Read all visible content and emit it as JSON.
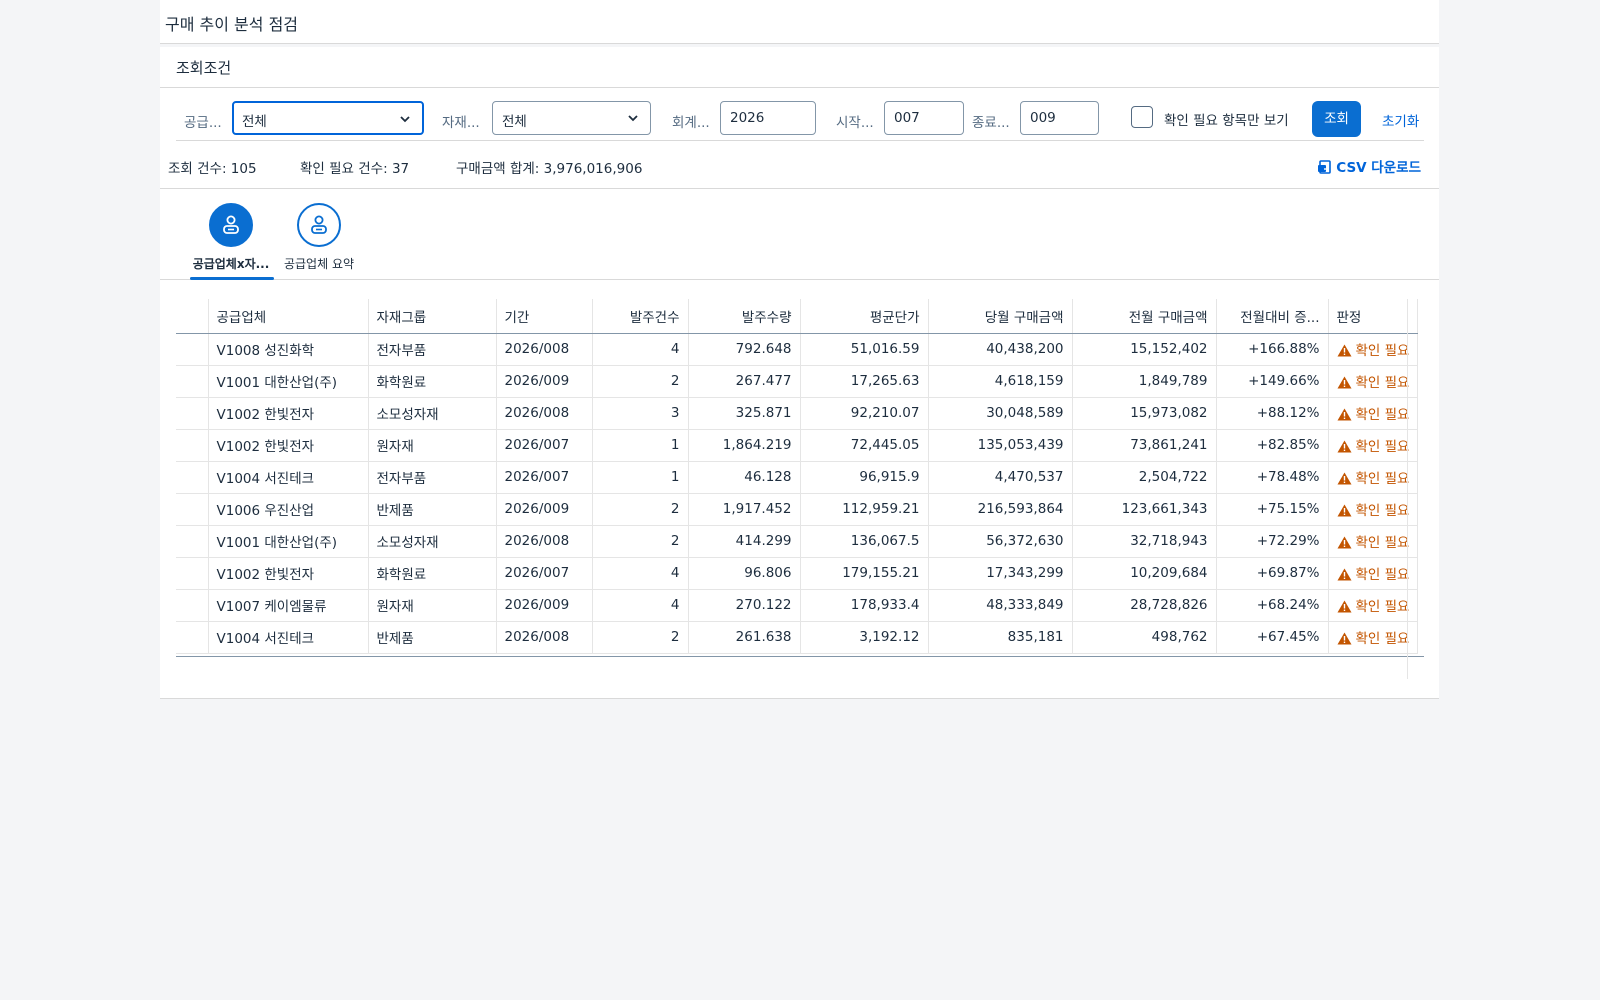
{
  "app": {
    "title": "구매 추이 분석 점검"
  },
  "filter": {
    "header": "조회조건",
    "supplier_label": "공급...",
    "supplier_value": "전체",
    "material_label": "자재...",
    "material_value": "전체",
    "fiscal_label": "회계...",
    "fiscal_value": "2026",
    "start_label": "시작...",
    "start_value": "007",
    "end_label": "종료...",
    "end_value": "009",
    "check_only_label": "확인 필요 항목만 보기",
    "search_button": "조회",
    "reset_button": "초기화"
  },
  "summary": {
    "count": "조회 건수: 105",
    "check_count": "확인 필요 건수: 37",
    "total": "구매금액 합계: 3,976,016,906",
    "csv": "CSV 다운로드"
  },
  "tabs": [
    {
      "label": "공급업체x자...",
      "icon": "person-icon",
      "active": true
    },
    {
      "label": "공급업체 요약",
      "icon": "person-icon",
      "active": false
    }
  ],
  "table": {
    "columns": [
      "공급업체",
      "자재그룹",
      "기간",
      "발주건수",
      "발주수량",
      "평균단가",
      "당월 구매금액",
      "전월 구매금액",
      "전월대비 증...",
      "판정"
    ],
    "rows": [
      [
        "V1008 성진화학",
        "전자부품",
        "2026/008",
        "4",
        "792.648",
        "51,016.59",
        "40,438,200",
        "15,152,402",
        "+166.88%",
        "확인 필요"
      ],
      [
        "V1001 대한산업(주)",
        "화학원료",
        "2026/009",
        "2",
        "267.477",
        "17,265.63",
        "4,618,159",
        "1,849,789",
        "+149.66%",
        "확인 필요"
      ],
      [
        "V1002 한빛전자",
        "소모성자재",
        "2026/008",
        "3",
        "325.871",
        "92,210.07",
        "30,048,589",
        "15,973,082",
        "+88.12%",
        "확인 필요"
      ],
      [
        "V1002 한빛전자",
        "원자재",
        "2026/007",
        "1",
        "1,864.219",
        "72,445.05",
        "135,053,439",
        "73,861,241",
        "+82.85%",
        "확인 필요"
      ],
      [
        "V1004 서진테크",
        "전자부품",
        "2026/007",
        "1",
        "46.128",
        "96,915.9",
        "4,470,537",
        "2,504,722",
        "+78.48%",
        "확인 필요"
      ],
      [
        "V1006 우진산업",
        "반제품",
        "2026/009",
        "2",
        "1,917.452",
        "112,959.21",
        "216,593,864",
        "123,661,343",
        "+75.15%",
        "확인 필요"
      ],
      [
        "V1001 대한산업(주)",
        "소모성자재",
        "2026/008",
        "2",
        "414.299",
        "136,067.5",
        "56,372,630",
        "32,718,943",
        "+72.29%",
        "확인 필요"
      ],
      [
        "V1002 한빛전자",
        "화학원료",
        "2026/007",
        "4",
        "96.806",
        "179,155.21",
        "17,343,299",
        "10,209,684",
        "+69.87%",
        "확인 필요"
      ],
      [
        "V1007 케이엠물류",
        "원자재",
        "2026/009",
        "4",
        "270.122",
        "178,933.4",
        "48,333,849",
        "28,728,826",
        "+68.24%",
        "확인 필요"
      ],
      [
        "V1004 서진테크",
        "반제품",
        "2026/008",
        "2",
        "261.638",
        "3,192.12",
        "835,181",
        "498,762",
        "+67.45%",
        "확인 필요"
      ]
    ]
  },
  "colors": {
    "accent": "#0a6ed1",
    "warning": "#c35500",
    "link": "#0064d9"
  }
}
